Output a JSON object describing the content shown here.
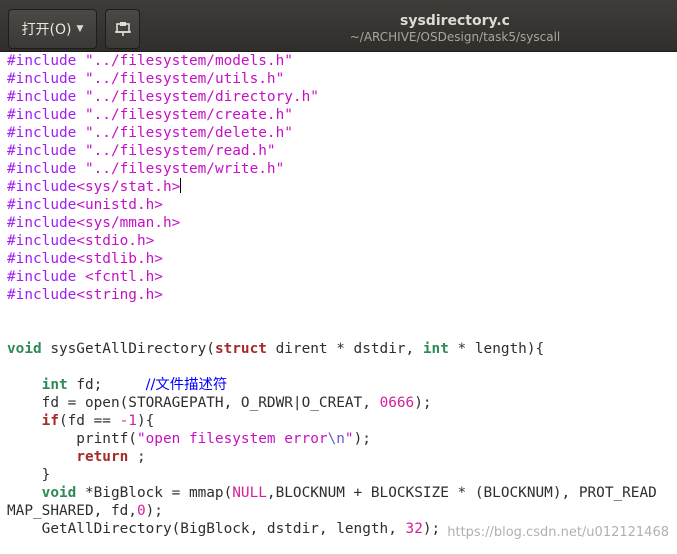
{
  "header": {
    "open_label": "打开(O)",
    "open_icon": "chevron-down-icon",
    "pin_icon": "document-pin-icon",
    "title": "sysdirectory.c",
    "path": "~/ARCHIVE/OSDesign/task5/syscall"
  },
  "editor": {
    "lines": [
      [
        {
          "t": "#include ",
          "c": "pp"
        },
        {
          "t": "\"../filesystem/models.h\"",
          "c": "str"
        }
      ],
      [
        {
          "t": "#include ",
          "c": "pp"
        },
        {
          "t": "\"../filesystem/utils.h\"",
          "c": "str"
        }
      ],
      [
        {
          "t": "#include ",
          "c": "pp"
        },
        {
          "t": "\"../filesystem/directory.h\"",
          "c": "str"
        }
      ],
      [
        {
          "t": "#include ",
          "c": "pp"
        },
        {
          "t": "\"../filesystem/create.h\"",
          "c": "str"
        }
      ],
      [
        {
          "t": "#include ",
          "c": "pp"
        },
        {
          "t": "\"../filesystem/delete.h\"",
          "c": "str"
        }
      ],
      [
        {
          "t": "#include ",
          "c": "pp"
        },
        {
          "t": "\"../filesystem/read.h\"",
          "c": "str"
        }
      ],
      [
        {
          "t": "#include ",
          "c": "pp"
        },
        {
          "t": "\"../filesystem/write.h\"",
          "c": "str"
        }
      ],
      [
        {
          "t": "#include",
          "c": "pp"
        },
        {
          "t": "<sys/stat.h>",
          "c": "str"
        },
        {
          "t": "",
          "c": "cursor"
        }
      ],
      [
        {
          "t": "#include",
          "c": "pp"
        },
        {
          "t": "<unistd.h>",
          "c": "str"
        }
      ],
      [
        {
          "t": "#include",
          "c": "pp"
        },
        {
          "t": "<sys/mman.h>",
          "c": "str"
        }
      ],
      [
        {
          "t": "#include",
          "c": "pp"
        },
        {
          "t": "<stdio.h>",
          "c": "str"
        }
      ],
      [
        {
          "t": "#include",
          "c": "pp"
        },
        {
          "t": "<stdlib.h>",
          "c": "str"
        }
      ],
      [
        {
          "t": "#include ",
          "c": "pp"
        },
        {
          "t": "<fcntl.h>",
          "c": "str"
        }
      ],
      [
        {
          "t": "#include",
          "c": "pp"
        },
        {
          "t": "<string.h>",
          "c": "str"
        }
      ],
      [],
      [],
      [
        {
          "t": "void",
          "c": "type"
        },
        {
          "t": " sysGetAllDirectory(",
          "c": ""
        },
        {
          "t": "struct",
          "c": "kw"
        },
        {
          "t": " dirent * dstdir, ",
          "c": ""
        },
        {
          "t": "int",
          "c": "type"
        },
        {
          "t": " * length){",
          "c": ""
        }
      ],
      [],
      [
        {
          "t": "    ",
          "c": ""
        },
        {
          "t": "int",
          "c": "type"
        },
        {
          "t": " fd;     ",
          "c": ""
        },
        {
          "t": "//文件描述符",
          "c": "cmt"
        }
      ],
      [
        {
          "t": "    fd = open(STORAGEPATH, O_RDWR|O_CREAT, ",
          "c": ""
        },
        {
          "t": "0666",
          "c": "num"
        },
        {
          "t": ");",
          "c": ""
        }
      ],
      [
        {
          "t": "    ",
          "c": ""
        },
        {
          "t": "if",
          "c": "kw"
        },
        {
          "t": "(fd == ",
          "c": ""
        },
        {
          "t": "-1",
          "c": "num"
        },
        {
          "t": "){",
          "c": ""
        }
      ],
      [
        {
          "t": "        printf(",
          "c": ""
        },
        {
          "t": "\"open filesystem error",
          "c": "str"
        },
        {
          "t": "\\n",
          "c": "esc"
        },
        {
          "t": "\"",
          "c": "str"
        },
        {
          "t": ");",
          "c": ""
        }
      ],
      [
        {
          "t": "        ",
          "c": ""
        },
        {
          "t": "return",
          "c": "kw"
        },
        {
          "t": " ;",
          "c": ""
        }
      ],
      [
        {
          "t": "    }",
          "c": ""
        }
      ],
      [
        {
          "t": "    ",
          "c": ""
        },
        {
          "t": "void",
          "c": "type"
        },
        {
          "t": " *BigBlock = mmap(",
          "c": ""
        },
        {
          "t": "NULL",
          "c": "num"
        },
        {
          "t": ",BLOCKNUM + BLOCKSIZE * (BLOCKNUM), PROT_READ",
          "c": ""
        }
      ],
      [
        {
          "t": "MAP_SHARED, fd,",
          "c": ""
        },
        {
          "t": "0",
          "c": "num"
        },
        {
          "t": ");",
          "c": ""
        }
      ],
      [
        {
          "t": "    GetAllDirectory(BigBlock, dstdir, length, ",
          "c": ""
        },
        {
          "t": "32",
          "c": "num"
        },
        {
          "t": ");",
          "c": ""
        }
      ]
    ]
  },
  "watermark": "https://blog.csdn.net/u012121468"
}
